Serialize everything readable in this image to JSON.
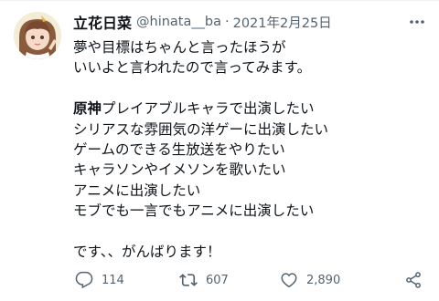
{
  "tweet": {
    "display_name": "立花日菜",
    "handle": "@hinata__ba",
    "separator": "·",
    "date": "2021年2月25日",
    "lines": [
      "夢や目標はちゃんと言ったほうが",
      "いいよと言われたので言ってみます。",
      "",
      "プレイアブルキャラで出演したい",
      "シリアスな雰囲気の洋ゲーに出演したい",
      "ゲームのできる生放送をやりたい",
      "キャラソンやイメソンを歌いたい",
      "アニメに出演したい",
      "モブでも一言でもアニメに出演したい",
      "",
      "です、、がんばります！"
    ],
    "emphasis": "原神",
    "replies": "114",
    "retweets": "607",
    "likes": "2,890",
    "icons": {
      "more": "more-horizontal-icon",
      "reply": "reply-icon",
      "retweet": "retweet-icon",
      "like": "heart-icon",
      "share": "share-icon"
    },
    "colors": {
      "text": "#0f1419",
      "secondary": "#536471",
      "background": "#ffffff"
    }
  }
}
